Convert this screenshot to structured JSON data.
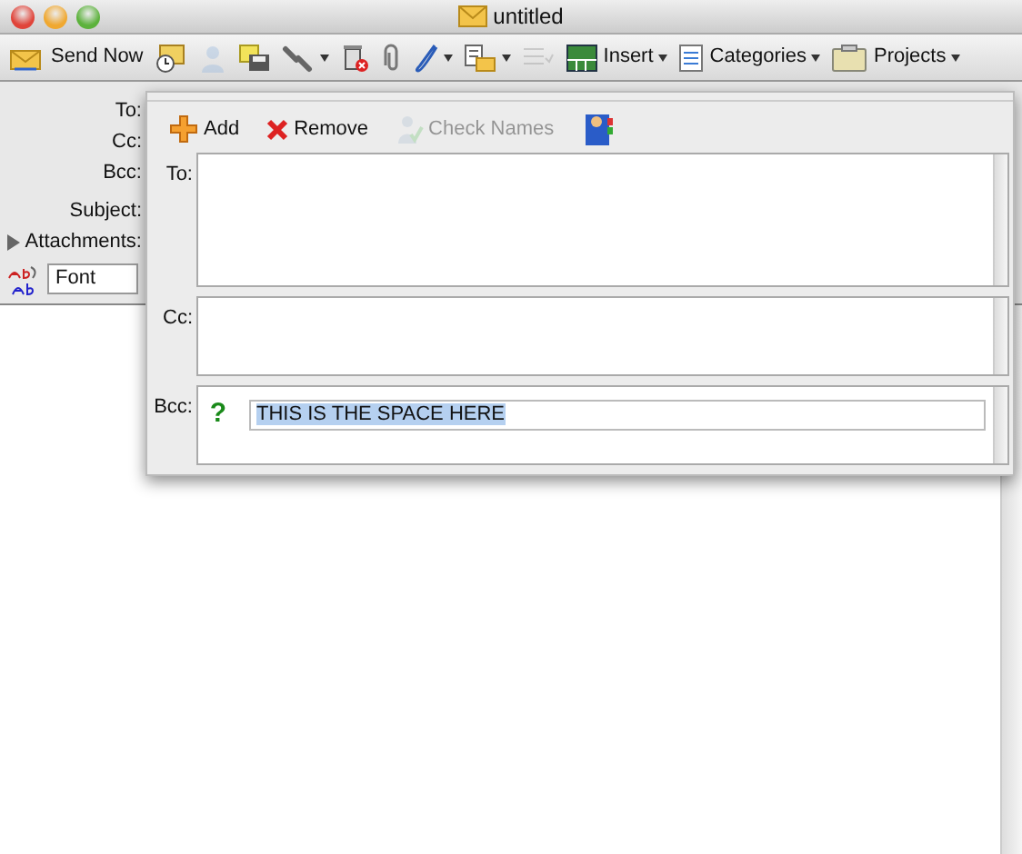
{
  "window": {
    "title": "untitled"
  },
  "toolbar": [
    {
      "kind": "button",
      "label": "Send Now",
      "disabled": false,
      "menu": false
    },
    {
      "kind": "icon",
      "disabled": false,
      "menu": false
    },
    {
      "kind": "icon",
      "disabled": true,
      "menu": false
    },
    {
      "kind": "icon",
      "disabled": false,
      "menu": false
    },
    {
      "kind": "icon",
      "disabled": false,
      "menu": true
    },
    {
      "kind": "icon",
      "disabled": false,
      "menu": false
    },
    {
      "kind": "icon",
      "disabled": false,
      "menu": false
    },
    {
      "kind": "icon",
      "disabled": false,
      "menu": true
    },
    {
      "kind": "icon",
      "disabled": false,
      "menu": true
    },
    {
      "kind": "icon",
      "disabled": true,
      "menu": false
    },
    {
      "kind": "button",
      "label": "Insert",
      "disabled": false,
      "menu": true
    },
    {
      "kind": "button",
      "label": "Categories",
      "disabled": false,
      "menu": true
    },
    {
      "kind": "button",
      "label": "Projects",
      "disabled": false,
      "menu": true
    }
  ],
  "header": {
    "to": "To:",
    "cc": "Cc:",
    "bcc": "Bcc:",
    "subject": "Subject:",
    "attachments": {
      "label": "Attachments:",
      "expanded": false
    },
    "font": {
      "value": "Font"
    }
  },
  "address_sheet": {
    "toolbar": [
      {
        "kind": "button",
        "label": "Add",
        "disabled": false
      },
      {
        "kind": "button",
        "label": "Remove",
        "disabled": false
      },
      {
        "kind": "button",
        "label": "Check Names",
        "disabled": true
      },
      {
        "kind": "icon",
        "disabled": false
      }
    ],
    "fields": [
      {
        "label": "To:"
      },
      {
        "label": "Cc:"
      },
      {
        "label": "Bcc:",
        "entries": [
          {
            "status": "?",
            "value": "THIS IS THE SPACE HERE",
            "selected": true
          }
        ]
      }
    ]
  }
}
